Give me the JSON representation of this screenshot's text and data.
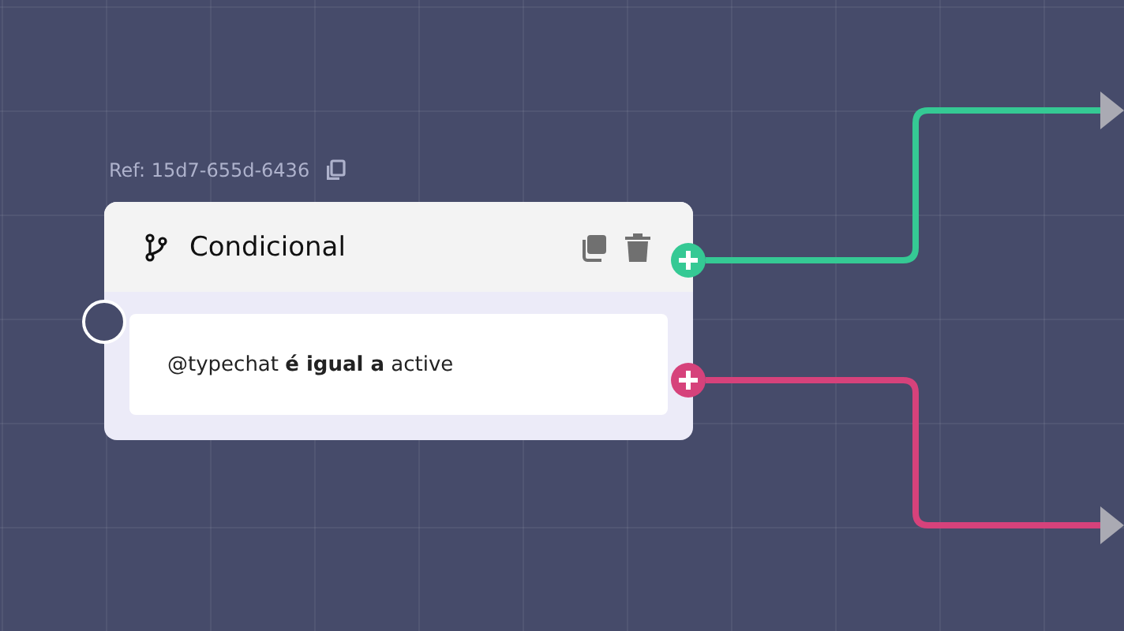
{
  "node": {
    "ref": "Ref: 15d7-655d-6436",
    "title": "Condicional",
    "condition": "@typechat **é igual a** active"
  },
  "outputs": [
    {
      "color": "#35c994"
    },
    {
      "color": "#d6427b"
    }
  ]
}
